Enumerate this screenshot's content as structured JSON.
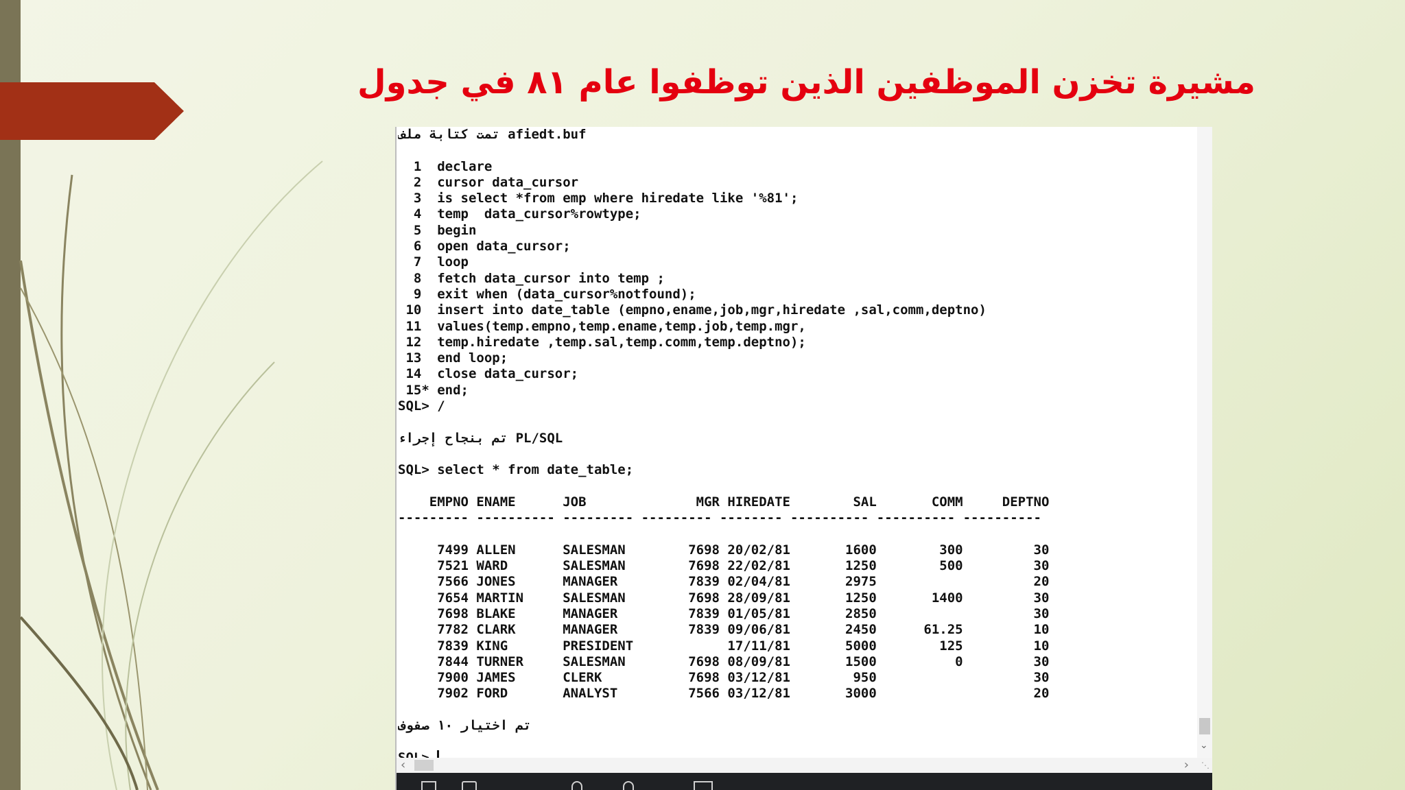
{
  "slide": {
    "title": "مشيرة تخزن الموظفين الذين توظفوا عام ٨١ في جدول"
  },
  "colors": {
    "title": "#e4000f",
    "arrow": "#a23016",
    "left_bar": "#7a7456",
    "console_bg": "#ffffff",
    "taskbar": "#1f2124"
  },
  "console": {
    "lines": [
      "تمت كتابة ملف afiedt.buf",
      "",
      "  1  declare",
      "  2  cursor data_cursor",
      "  3  is select *from emp where hiredate like '%81';",
      "  4  temp  data_cursor%rowtype;",
      "  5  begin",
      "  6  open data_cursor;",
      "  7  loop",
      "  8  fetch data_cursor into temp ;",
      "  9  exit when (data_cursor%notfound);",
      " 10  insert into date_table (empno,ename,job,mgr,hiredate ,sal,comm,deptno)",
      " 11  values(temp.empno,temp.ename,temp.job,temp.mgr,",
      " 12  temp.hiredate ,temp.sal,temp.comm,temp.deptno);",
      " 13  end loop;",
      " 14  close data_cursor;",
      " 15* end;",
      "SQL> /",
      "",
      "تم بنجاح إجراء PL/SQL",
      "",
      "SQL> select * from date_table;",
      "",
      "    EMPNO ENAME      JOB              MGR HIREDATE        SAL       COMM     DEPTNO",
      "--------- ---------- --------- --------- -------- ---------- ---------- ----------",
      "",
      "     7499 ALLEN      SALESMAN        7698 20/02/81       1600        300         30",
      "     7521 WARD       SALESMAN        7698 22/02/81       1250        500         30",
      "     7566 JONES      MANAGER         7839 02/04/81       2975                    20",
      "     7654 MARTIN     SALESMAN        7698 28/09/81       1250       1400         30",
      "     7698 BLAKE      MANAGER         7839 01/05/81       2850                    30",
      "     7782 CLARK      MANAGER         7839 09/06/81       2450      61.25         10",
      "     7839 KING       PRESIDENT            17/11/81       5000        125         10",
      "     7844 TURNER     SALESMAN        7698 08/09/81       1500          0         30",
      "     7900 JAMES      CLERK           7698 03/12/81        950                    30",
      "     7902 FORD       ANALYST         7566 03/12/81       3000                    20",
      "",
      "تم اختيار ١٠ صفوف",
      "",
      "SQL> "
    ]
  },
  "icons": {
    "scroll_down": "chevron-down-icon",
    "scroll_left": "chevron-left-icon",
    "scroll_right": "chevron-right-icon",
    "decor_arrow": "arrow-shape"
  }
}
